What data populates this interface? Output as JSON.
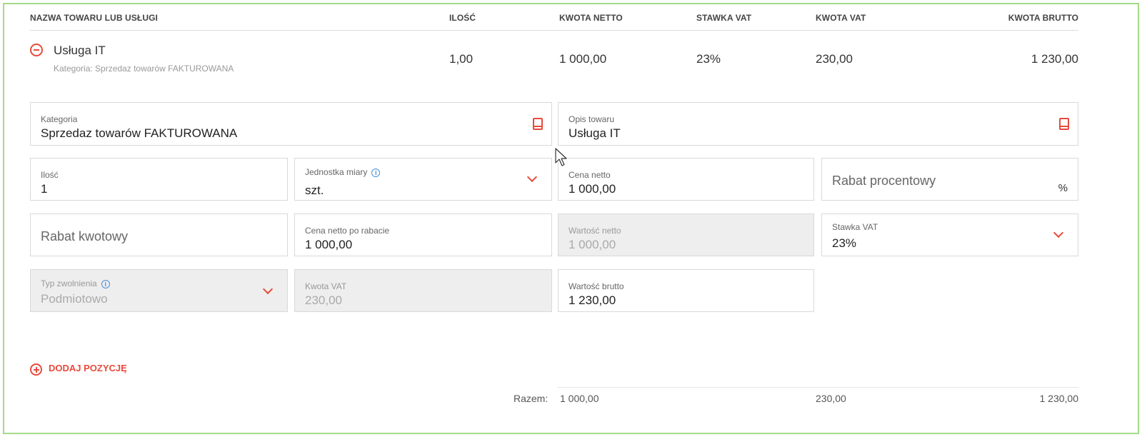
{
  "header": {
    "name": "NAZWA TOWARU LUB USŁUGI",
    "qty": "ILOŚĆ",
    "net": "KWOTA NETTO",
    "vat_rate": "STAWKA VAT",
    "vat_amount": "KWOTA VAT",
    "gross": "KWOTA BRUTTO"
  },
  "item": {
    "name": "Usługa IT",
    "category_line": "Kategoria: Sprzedaz towarów FAKTUROWANA",
    "qty": "1,00",
    "net": "1 000,00",
    "vat_rate": "23%",
    "vat_amount": "230,00",
    "gross": "1 230,00"
  },
  "form": {
    "category": {
      "label": "Kategoria",
      "value": "Sprzedaz towarów FAKTUROWANA"
    },
    "description": {
      "label": "Opis towaru",
      "value": "Usługa IT"
    },
    "quantity": {
      "label": "Ilość",
      "value": "1"
    },
    "unit": {
      "label": "Jednostka miary",
      "value": "szt."
    },
    "net_price": {
      "label": "Cena netto",
      "value": "1 000,00"
    },
    "percent_discount": {
      "placeholder": "Rabat procentowy",
      "suffix": "%"
    },
    "amount_discount": {
      "placeholder": "Rabat kwotowy"
    },
    "net_after_discount": {
      "label": "Cena netto po rabacie",
      "value": "1 000,00"
    },
    "net_value": {
      "label": "Wartość netto",
      "value": "1 000,00"
    },
    "vat_rate": {
      "label": "Stawka VAT",
      "value": "23%"
    },
    "exemption_type": {
      "label": "Typ zwolnienia",
      "value": "Podmiotowo"
    },
    "vat_amount": {
      "label": "Kwota VAT",
      "value": "230,00"
    },
    "gross_value": {
      "label": "Wartość brutto",
      "value": "1 230,00"
    }
  },
  "actions": {
    "add_position": "DODAJ POZYCJĘ"
  },
  "totals": {
    "label": "Razem:",
    "net": "1 000,00",
    "vat": "230,00",
    "gross": "1 230,00"
  },
  "colors": {
    "accent": "#e84a3c",
    "border": "#a6d98a",
    "info": "#4a90d9"
  }
}
